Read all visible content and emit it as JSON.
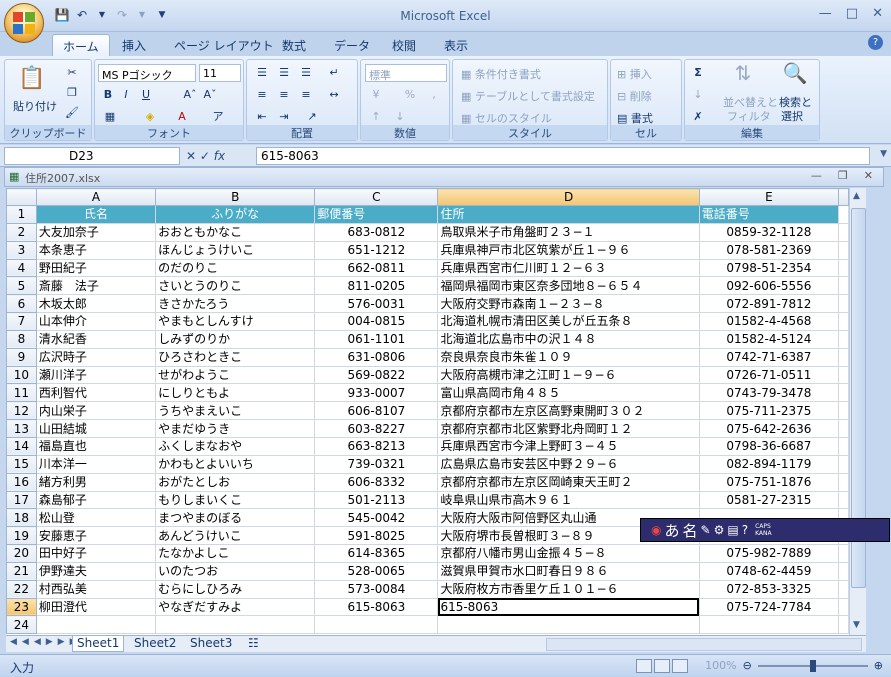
{
  "window": {
    "title": "Microsoft Excel"
  },
  "ribbon_tabs": [
    "ホーム",
    "挿入",
    "ページ レイアウト",
    "数式",
    "データ",
    "校閲",
    "表示"
  ],
  "ribbon": {
    "clipboard": {
      "paste": "貼り付け",
      "label": "クリップボード"
    },
    "font": {
      "name": "MS Pゴシック",
      "size": "11",
      "label": "フォント"
    },
    "alignment": {
      "label": "配置"
    },
    "number": {
      "format": "標準",
      "label": "数値"
    },
    "styles": {
      "conditional": "条件付き書式",
      "table": "テーブルとして書式設定",
      "cell": "セルのスタイル",
      "label": "スタイル"
    },
    "cells": {
      "insert": "挿入",
      "delete": "削除",
      "format": "書式",
      "label": "セル"
    },
    "editing": {
      "sort": "並べ替えと",
      "filter": "フィルタ",
      "find": "検索と",
      "select": "選択",
      "label": "編集"
    }
  },
  "formula_bar": {
    "name_box": "D23",
    "fx": "fx",
    "value": "615-8063"
  },
  "document": {
    "filename": "住所2007.xlsx"
  },
  "columns": [
    "A",
    "B",
    "C",
    "D",
    "E"
  ],
  "header_row": [
    "氏名",
    "ふりがな",
    "郵便番号",
    "住所",
    "電話番号"
  ],
  "rows": [
    [
      "大友加奈子",
      "おおともかなこ",
      "683-0812",
      "鳥取県米子市角盤町２３−１",
      "0859-32-1128"
    ],
    [
      "本条恵子",
      "ほんじょうけいこ",
      "651-1212",
      "兵庫県神戸市北区筑紫が丘１−９６",
      "078-581-2369"
    ],
    [
      "野田紀子",
      "のだのりこ",
      "662-0811",
      "兵庫県西宮市仁川町１２−６３",
      "0798-51-2354"
    ],
    [
      "斎藤　法子",
      "さいとうのりこ",
      "811-0205",
      "福岡県福岡市東区奈多団地８−６５４",
      "092-606-5556"
    ],
    [
      "木坂太郎",
      "きさかたろう",
      "576-0031",
      "大阪府交野市森南１−２３−８",
      "072-891-7812"
    ],
    [
      "山本伸介",
      "やまもとしんすけ",
      "004-0815",
      "北海道札幌市清田区美しが丘五条８",
      "01582-4-4568"
    ],
    [
      "清水紀香",
      "しみずのりか",
      "061-1101",
      "北海道北広島市中の沢１４８",
      "01582-4-5124"
    ],
    [
      "広沢時子",
      "ひろさわときこ",
      "631-0806",
      "奈良県奈良市朱雀１０９",
      "0742-71-6387"
    ],
    [
      "瀬川洋子",
      "せがわようこ",
      "569-0822",
      "大阪府高槻市津之江町１−９−６",
      "0726-71-0511"
    ],
    [
      "西利智代",
      "にしりともよ",
      "933-0007",
      "富山県高岡市角４８５",
      "0743-79-3478"
    ],
    [
      "内山栄子",
      "うちやまえいこ",
      "606-8107",
      "京都府京都市左京区高野東開町３０２",
      "075-711-2375"
    ],
    [
      "山田結城",
      "やまだゆうき",
      "603-8227",
      "京都府京都市北区紫野北舟岡町１２",
      "075-642-2636"
    ],
    [
      "福島直也",
      "ふくしまなおや",
      "663-8213",
      "兵庫県西宮市今津上野町３−４５",
      "0798-36-6687"
    ],
    [
      "川本洋一",
      "かわもとよいいち",
      "739-0321",
      "広島県広島市安芸区中野２９−６",
      "082-894-1179"
    ],
    [
      "緒方利男",
      "おがたとしお",
      "606-8332",
      "京都府京都市左京区岡崎東天王町２",
      "075-751-1876"
    ],
    [
      "森島郁子",
      "もりしまいくこ",
      "501-2113",
      "岐阜県山県市高木９６１",
      "0581-27-2315"
    ],
    [
      "松山登",
      "まつやまのぼる",
      "545-0042",
      "大阪府大阪市阿倍野区丸山通",
      ""
    ],
    [
      "安藤恵子",
      "あんどうけいこ",
      "591-8025",
      "大阪府堺市長曽根町３−８９",
      ""
    ],
    [
      "田中好子",
      "たなかよしこ",
      "614-8365",
      "京都府八幡市男山金振４５−８",
      "075-982-7889"
    ],
    [
      "伊野達夫",
      "いのたつお",
      "528-0065",
      "滋賀県甲賀市水口町春日９８６",
      "0748-62-4459"
    ],
    [
      "村西弘美",
      "むらにしひろみ",
      "573-0084",
      "大阪府枚方市香里ケ丘１０１−６",
      "072-853-3325"
    ],
    [
      "柳田澄代",
      "やなぎだすみよ",
      "615-8063",
      "615-8063",
      "075-724-7784"
    ],
    [
      "",
      "",
      "",
      "",
      ""
    ]
  ],
  "row_numbers": [
    "1",
    "2",
    "3",
    "4",
    "5",
    "6",
    "7",
    "8",
    "9",
    "10",
    "11",
    "12",
    "13",
    "14",
    "15",
    "16",
    "17",
    "18",
    "19",
    "20",
    "21",
    "22",
    "23",
    "24"
  ],
  "sheet_tabs": [
    "Sheet1",
    "Sheet2",
    "Sheet3"
  ],
  "status": {
    "mode": "入力",
    "zoom": "100%"
  },
  "ime": {
    "mode": "あ",
    "kanji": "名",
    "caps": "CAPS",
    "kana": "KANA"
  }
}
